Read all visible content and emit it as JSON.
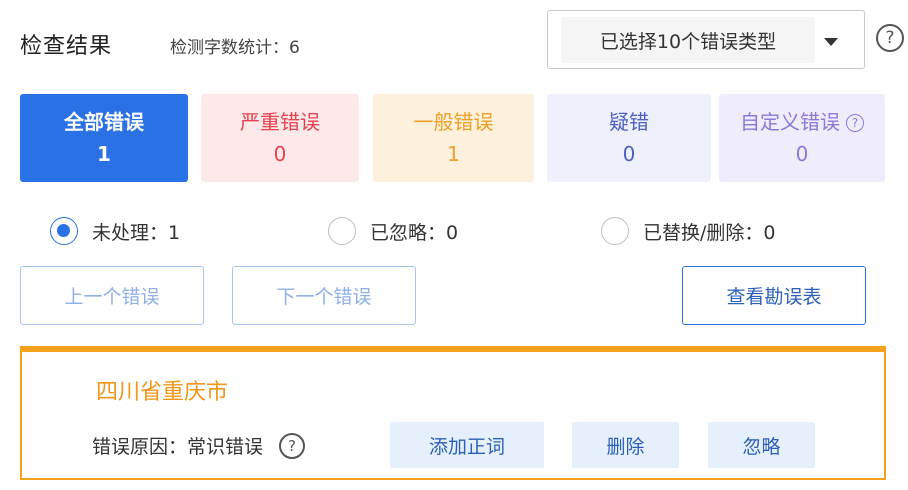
{
  "header": {
    "title": "检查结果",
    "word_count": "检测字数统计：6",
    "type_select_value": "已选择10个错误类型",
    "help_icon": "?"
  },
  "categories": [
    {
      "label": "全部错误",
      "count": "1",
      "color": "#2b71e6"
    },
    {
      "label": "严重错误",
      "count": "0",
      "color": "#e8414f"
    },
    {
      "label": "一般错误",
      "count": "1",
      "color": "#f0a025"
    },
    {
      "label": "疑错",
      "count": "0",
      "color": "#4e5fc2"
    },
    {
      "label": "自定义错误",
      "count": "0",
      "color": "#8b78d8"
    }
  ],
  "status_filter": [
    {
      "label": "未处理：1",
      "selected": true
    },
    {
      "label": "已忽略：0",
      "selected": false
    },
    {
      "label": "已替换/删除：0",
      "selected": false
    }
  ],
  "nav": {
    "prev": "上一个错误",
    "next": "下一个错误",
    "view_table": "查看勘误表"
  },
  "error_item": {
    "text": "四川省重庆市",
    "reason": "错误原因：常识错误",
    "actions": {
      "add_correct": "添加正词",
      "delete": "删除",
      "ignore": "忽略"
    }
  },
  "colors": {
    "primary": "#2b71e6",
    "warning_border": "#f5a11c"
  }
}
